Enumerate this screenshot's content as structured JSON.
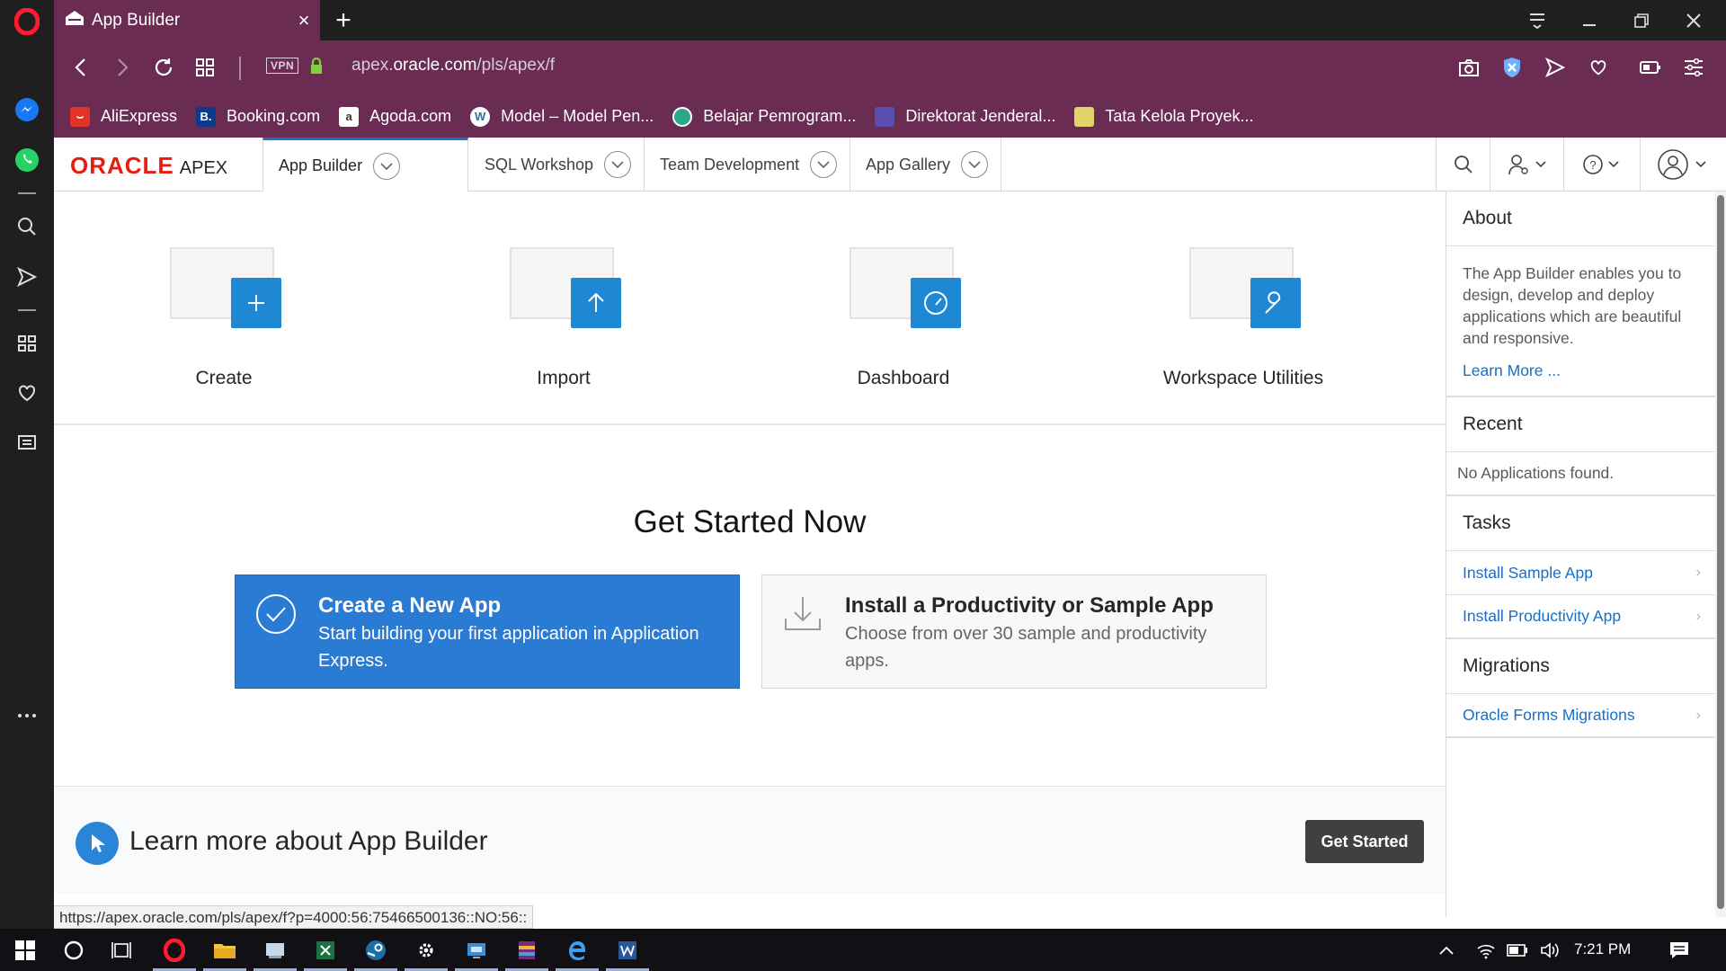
{
  "browser": {
    "tab_title": "App Builder",
    "url_prefix": "apex.",
    "url_domain": "oracle.com",
    "url_path": "/pls/apex/f",
    "vpn_label": "VPN",
    "bookmarks": [
      {
        "label": "AliExpress",
        "icon": "aliexpress-icon",
        "color": "#e43225"
      },
      {
        "label": "Booking.com",
        "icon": "booking-icon",
        "color": "#0c3b8a"
      },
      {
        "label": "Agoda.com",
        "icon": "agoda-icon",
        "color": "#ffffff"
      },
      {
        "label": "Model – Model Pen...",
        "icon": "wordpress-icon",
        "color": "#ffffff"
      },
      {
        "label": "Belajar Pemrogram...",
        "icon": "site-icon",
        "color": "#2aa889"
      },
      {
        "label": "Direktorat Jenderal...",
        "icon": "site-icon",
        "color": "#5a4fb0"
      },
      {
        "label": "Tata Kelola Proyek...",
        "icon": "site-icon",
        "color": "#e2d36a"
      }
    ],
    "status_url": "https://apex.oracle.com/pls/apex/f?p=4000:56:75466500136::NO:56::"
  },
  "apex": {
    "logo_oracle": "ORACLE",
    "logo_apex": "APEX",
    "menu": [
      {
        "label": "App Builder",
        "active": true
      },
      {
        "label": "SQL Workshop",
        "active": false
      },
      {
        "label": "Team Development",
        "active": false
      },
      {
        "label": "App Gallery",
        "active": false
      }
    ]
  },
  "main": {
    "cards": [
      {
        "label": "Create",
        "icon": "plus-icon"
      },
      {
        "label": "Import",
        "icon": "arrow-up-icon"
      },
      {
        "label": "Dashboard",
        "icon": "gauge-icon"
      },
      {
        "label": "Workspace Utilities",
        "icon": "wrench-icon"
      }
    ],
    "get_started_title": "Get Started Now",
    "create_app": {
      "title": "Create a New App",
      "desc": "Start building your first application in Application Express."
    },
    "install_app": {
      "title": "Install a Productivity or Sample App",
      "desc": "Choose from over 30 sample and productivity apps."
    },
    "learn_text": "Learn more about App Builder",
    "get_started_button": "Get Started"
  },
  "right_panel": {
    "about_title": "About",
    "about_text": "The App Builder enables you to design, develop and deploy applications which are beautiful and responsive.",
    "learn_more": "Learn More ...",
    "recent_title": "Recent",
    "recent_empty": "No Applications found.",
    "tasks_title": "Tasks",
    "tasks": [
      "Install Sample App",
      "Install Productivity App"
    ],
    "migrations_title": "Migrations",
    "migrations": [
      "Oracle Forms Migrations"
    ]
  },
  "taskbar": {
    "time": "7:21 PM"
  },
  "colors": {
    "browser_accent": "#6a2c53",
    "apex_blue": "#1e88d5",
    "oracle_red": "#e41f12"
  }
}
